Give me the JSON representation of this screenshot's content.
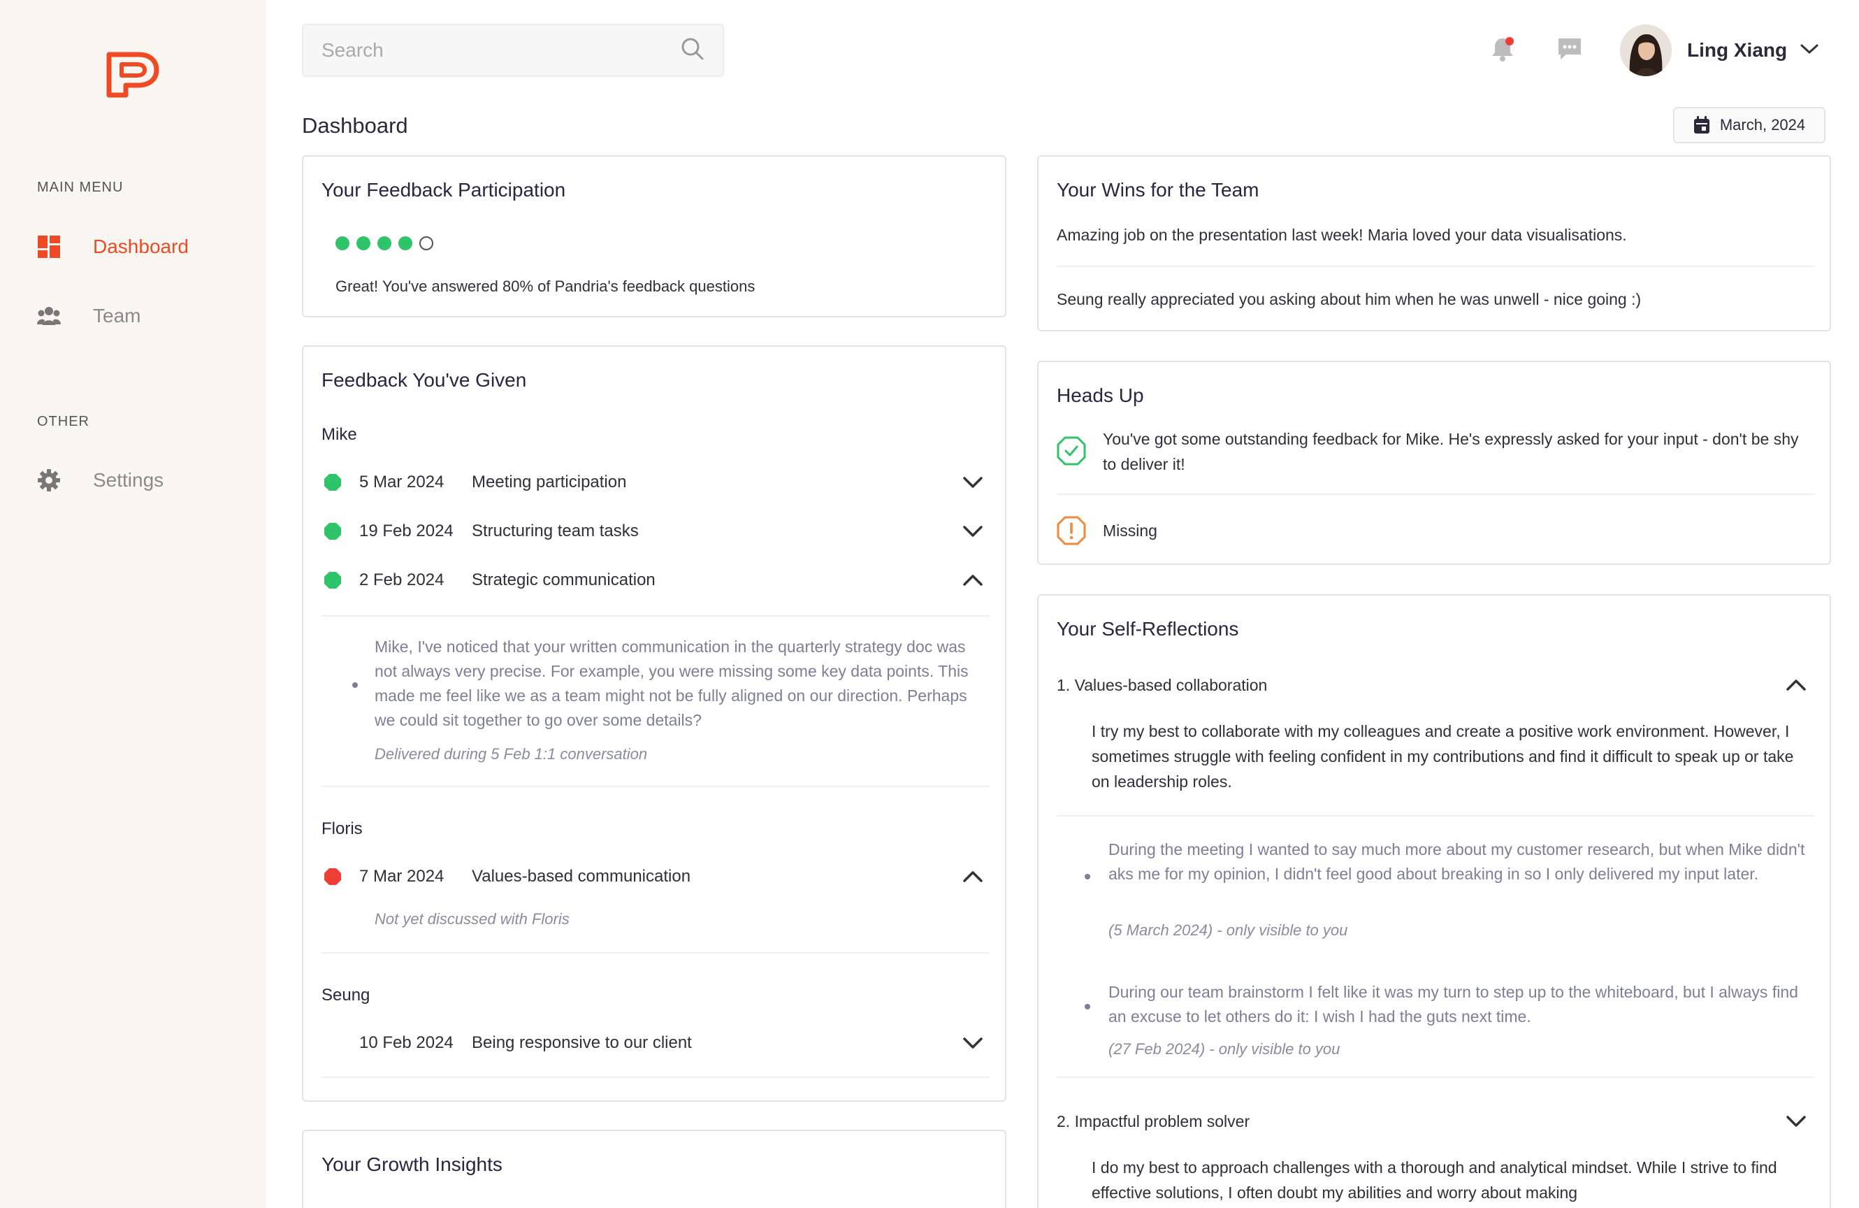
{
  "app": {
    "brand_color": "#ef4a23"
  },
  "sidebar": {
    "main_menu_title": "MAIN MENU",
    "other_title": "OTHER",
    "items": [
      {
        "label": "Dashboard",
        "icon": "dashboard-icon",
        "active": true
      },
      {
        "label": "Team",
        "icon": "team-icon",
        "active": false
      },
      {
        "label": "Settings",
        "icon": "gear-icon",
        "active": false
      }
    ]
  },
  "header": {
    "search_placeholder": "Search",
    "user_name": "Ling Xiang",
    "page_title": "Dashboard",
    "date_label": "March, 2024"
  },
  "participation": {
    "title": "Your Feedback Participation",
    "filled_dots": 4,
    "total_dots": 5,
    "message": "Great! You've answered 80% of Pandria's feedback questions"
  },
  "given": {
    "title": "Feedback You've Given",
    "groups": [
      {
        "person": "Mike",
        "items": [
          {
            "date": "5 Mar 2024",
            "topic": "Meeting participation",
            "status": "green"
          },
          {
            "date": "19 Feb 2024",
            "topic": "Structuring team tasks",
            "status": "green"
          },
          {
            "date": "2 Feb 2024",
            "topic": "Strategic communication",
            "status": "green",
            "detail": "Mike, I've noticed that your written communication in the quarterly strategy doc was not always very precise. For example, you were missing some key data points. This made me feel like we as a team might not be fully aligned on our direction. Perhaps we could sit together to go over some details?",
            "note": "Delivered during 5 Feb 1:1 conversation"
          }
        ]
      },
      {
        "person": "Floris",
        "items": [
          {
            "date": "7 Mar 2024",
            "topic": "Values-based communication",
            "status": "red",
            "note": "Not yet discussed with Floris"
          }
        ]
      },
      {
        "person": "Seung",
        "items": [
          {
            "date": "10 Feb 2024",
            "topic": "Being responsive to our client",
            "status": "none"
          }
        ]
      }
    ]
  },
  "growth": {
    "title": "Your Growth Insights"
  },
  "wins": {
    "title": "Your Wins for the Team",
    "items": [
      "Amazing job on the presentation last week! Maria loved your data visualisations.",
      "Seung really appreciated you asking about him when he was unwell - nice going :)"
    ]
  },
  "headsup": {
    "title": "Heads Up",
    "items": [
      {
        "text": "You've got some outstanding feedback for Mike. He's expressly asked for your input - don't be shy to deliver it!",
        "icon": "check-badge-icon"
      },
      {
        "text": "Missing",
        "icon": "warning-badge-icon"
      }
    ]
  },
  "reflections": {
    "title": "Your Self-Reflections",
    "sections": [
      {
        "heading": "1. Values-based collaboration",
        "body": "I try my best to collaborate with my colleagues and create a positive work environment. However, I sometimes struggle with feeling confident in my contributions and find it difficult to speak up or take on leadership roles.",
        "notes": [
          {
            "text": "During the meeting I wanted to say much more about my customer research, but when Mike didn't aks me for my opinion, I didn't feel good about breaking in so I only delivered my input later.",
            "meta": "(5 March 2024) - only visible to you"
          },
          {
            "text": "During our team brainstorm I felt like it was my turn to step up to the whiteboard, but I always find an excuse to let others do it: I wish I had the guts next time.",
            "meta": "(27 Feb 2024) - only visible to you"
          }
        ]
      },
      {
        "heading": "2. Impactful problem solver",
        "body": "I do my best to approach challenges with a thorough and analytical mindset. While I strive to find effective solutions, I often doubt my abilities and worry about making"
      }
    ]
  }
}
